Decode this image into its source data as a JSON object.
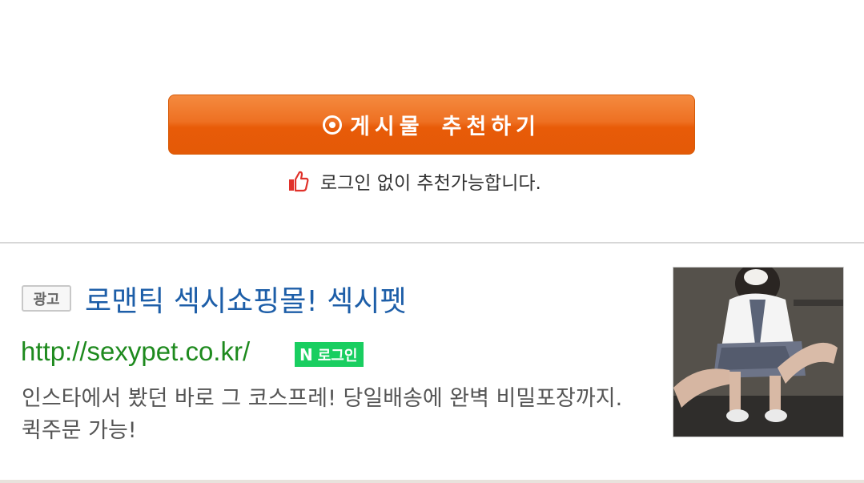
{
  "recommend": {
    "button_label": "게시물",
    "button_label2": "추천하기",
    "note": "로그인 없이 추천가능합니다."
  },
  "ad": {
    "badge": "광고",
    "title": "로맨틱 섹시쇼핑몰! 섹시펫",
    "url": "http://sexypet.co.kr/",
    "naver_login_n": "N",
    "naver_login_label": "로그인",
    "description": "인스타에서 봤던 바로 그 코스프레! 당일배송에 완벽 비밀포장까지. 퀵주문 가능!"
  },
  "colors": {
    "button_orange": "#ee6a10",
    "title_blue": "#1d5ea8",
    "url_green": "#1e8a1e",
    "naver_green": "#19ce60"
  }
}
